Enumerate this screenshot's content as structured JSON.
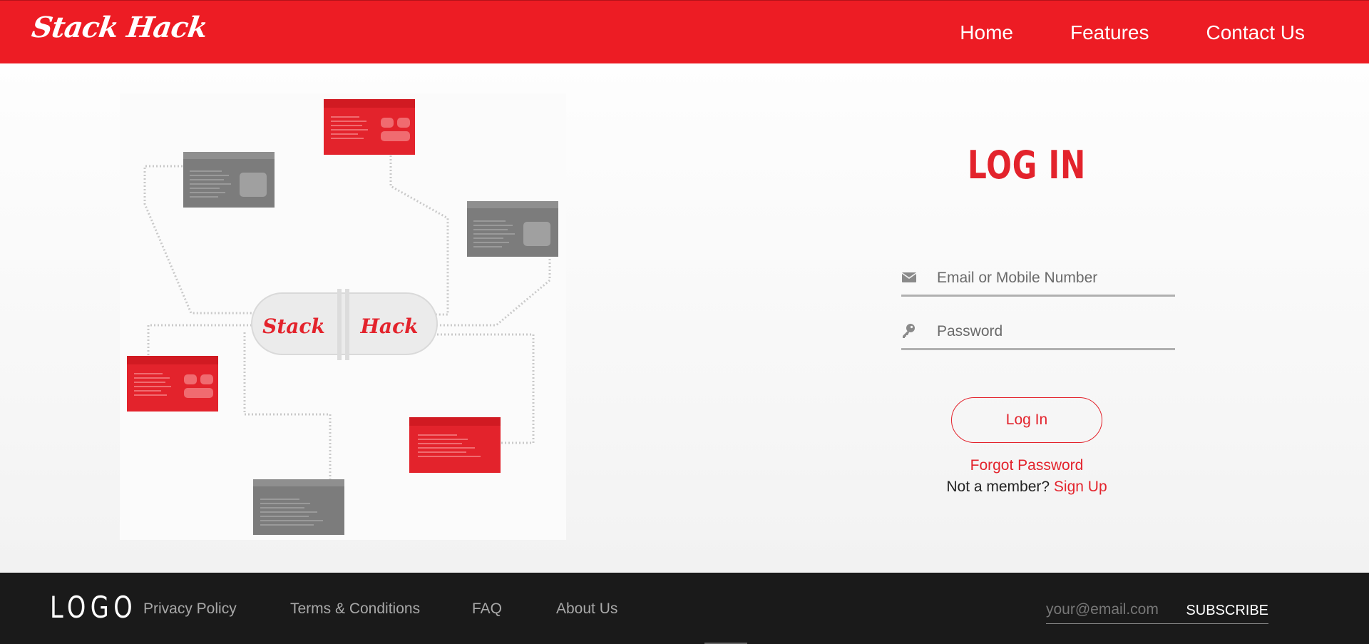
{
  "header": {
    "brand": "Stack Hack",
    "nav": [
      "Home",
      "Features",
      "Contact Us"
    ]
  },
  "illustration": {
    "hub_left": "Stack",
    "hub_right": "Hack"
  },
  "login": {
    "title": "LOG IN",
    "email_placeholder": "Email or Mobile Number",
    "password_placeholder": "Password",
    "button": "Log In",
    "forgot": "Forgot Password",
    "member_text": "Not a member?",
    "signup": "Sign Up"
  },
  "footer": {
    "logo": "LOGO",
    "links": [
      "Privacy Policy",
      "Terms & Conditions",
      "FAQ",
      "About Us"
    ],
    "email_placeholder": "your@email.com",
    "subscribe": "SUBSCRIBE"
  },
  "colors": {
    "accent": "#ed1c24",
    "footer_bg": "#1a1a1a",
    "card_gray": "#7a7a7a"
  },
  "icons": {
    "email": "envelope-icon",
    "password": "key-icon"
  }
}
